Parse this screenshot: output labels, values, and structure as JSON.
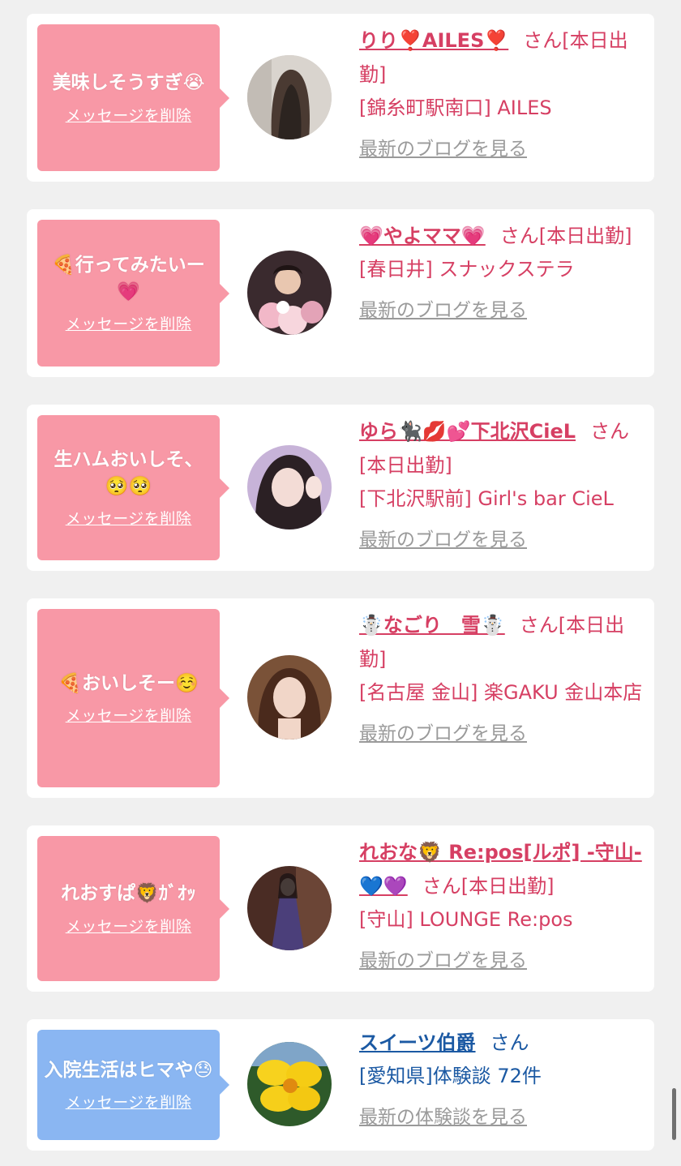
{
  "cards": [
    {
      "message": "美味しそうすぎ😭",
      "delete_label": "メッセージを削除",
      "name": "りり❣️AILES❣️",
      "san_status": "さん[本日出勤]",
      "shop": "[錦糸町駅南口] AILES",
      "blog_link": "最新のブログを見る"
    },
    {
      "message": "🍕行ってみたいー💗",
      "delete_label": "メッセージを削除",
      "name": "💗やよママ💗",
      "san_status": "さん[本日出勤]",
      "shop": "[春日井] スナックステラ",
      "blog_link": "最新のブログを見る"
    },
    {
      "message": "生ハムおいしそ、🥺🥺",
      "delete_label": "メッセージを削除",
      "name": "ゆら🐈‍⬛💋💕下北沢CieL",
      "san_status": "さん[本日出勤]",
      "shop": "[下北沢駅前] Girl's bar CieL",
      "blog_link": "最新のブログを見る"
    },
    {
      "message": "🍕おいしそー☺️",
      "delete_label": "メッセージを削除",
      "name": "☃️なごり　雪☃️",
      "san_status": "さん[本日出勤]",
      "shop": "[名古屋 金山] 楽GAKU 金山本店",
      "blog_link": "最新のブログを見る"
    },
    {
      "message": "れおすぱ🦁ｶﾞｵｯ",
      "delete_label": "メッセージを削除",
      "name": "れおな🦁 Re:pos[ルポ] -守山-💙💜",
      "san_status": "さん[本日出勤]",
      "shop": "[守山] LOUNGE Re:pos",
      "blog_link": "最新のブログを見る"
    },
    {
      "message": "入院生活はヒマや😓",
      "delete_label": "メッセージを削除",
      "name": "スイーツ伯爵",
      "san_status": "さん",
      "shop": "[愛知県]体験談 72件",
      "blog_link": "最新の体験談を見る"
    }
  ],
  "colors": {
    "pink_bubble": "#f898a6",
    "blue_bubble": "#8ab6f2",
    "name_pink": "#d63f63",
    "name_blue": "#1b59a3",
    "link_gray": "#9a9a9a"
  }
}
